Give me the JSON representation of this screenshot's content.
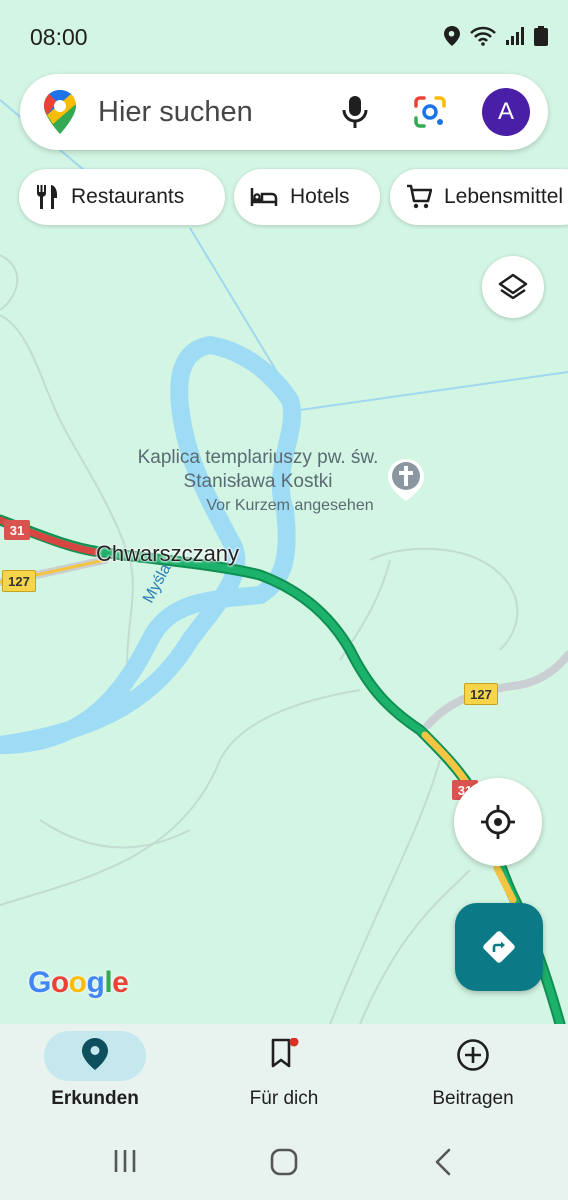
{
  "status": {
    "time": "08:00"
  },
  "search": {
    "placeholder": "Hier suchen",
    "avatar_letter": "A"
  },
  "chips": [
    {
      "label": "Restaurants",
      "icon": "fork-knife-icon"
    },
    {
      "label": "Hotels",
      "icon": "bed-icon"
    },
    {
      "label": "Lebensmittel",
      "icon": "shopping-cart-icon"
    }
  ],
  "map": {
    "poi": {
      "name": "Kaplica templariuszy pw. św. Stanisława Kostki",
      "status": "Vor Kurzem angesehen",
      "icon": "church-cross-icon"
    },
    "place_label": "Chwarszczany",
    "river_label": "Myśla",
    "road_shields": [
      "31",
      "127",
      "127",
      "31"
    ],
    "attribution": "Google"
  },
  "bottom_nav": [
    {
      "label": "Erkunden",
      "icon": "location-pin-icon",
      "active": true
    },
    {
      "label": "Für dich",
      "icon": "bookmark-icon",
      "active": false
    },
    {
      "label": "Beitragen",
      "icon": "add-circle-icon",
      "active": false
    }
  ],
  "colors": {
    "map_background": "#d3f5e3",
    "water": "#9edcf5",
    "traffic_green": "#1db26b",
    "traffic_yellow": "#f4c542",
    "traffic_red": "#d64541",
    "accent": "#0b7a86",
    "avatar": "#4a1fa8"
  }
}
